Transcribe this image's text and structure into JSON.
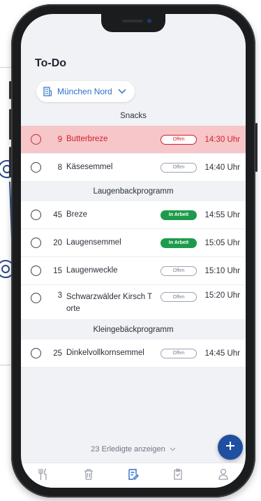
{
  "header": {
    "title": "To-Do"
  },
  "location": {
    "label": "München Nord"
  },
  "sections": [
    {
      "title": "Snacks",
      "items": [
        {
          "qty": "9",
          "name": "Butterbreze",
          "status": "Offen",
          "time": "14:30 Uhr",
          "variant": "alert"
        },
        {
          "qty": "8",
          "name": "Käsesemmel",
          "status": "Offen",
          "time": "14:40 Uhr",
          "variant": "open"
        }
      ]
    },
    {
      "title": "Laugenbackprogramm",
      "items": [
        {
          "qty": "45",
          "name": "Breze",
          "status": "In Arbeit",
          "time": "14:55 Uhr",
          "variant": "progress"
        },
        {
          "qty": "20",
          "name": "Laugensemmel",
          "status": "In Arbeit",
          "time": "15:05 Uhr",
          "variant": "progress"
        },
        {
          "qty": "15",
          "name": "Laugenweckle",
          "status": "Offen",
          "time": "15:10 Uhr",
          "variant": "open"
        },
        {
          "qty": "3",
          "name": "Schwarzwälder Kirsch T orte",
          "status": "Offen",
          "time": "15:20 Uhr",
          "variant": "open"
        }
      ]
    },
    {
      "title": "Kleingebäckprogramm",
      "items": [
        {
          "qty": "25",
          "name": "Dinkelvollkornsemmel",
          "status": "Offen",
          "time": "14:45 Uhr",
          "variant": "open"
        }
      ]
    }
  ],
  "footer": {
    "done_label": "23 Erledigte anzeigen"
  },
  "tabs": [
    {
      "icon": "cutlery-icon"
    },
    {
      "icon": "trash-icon"
    },
    {
      "icon": "list-edit-icon",
      "active": true
    },
    {
      "icon": "clipboard-icon"
    },
    {
      "icon": "user-icon"
    }
  ],
  "colors": {
    "accent": "#2d6fc7",
    "alert": "#d11f2b",
    "alert_bg": "#f6c6c9",
    "progress": "#1c9c4a",
    "fab": "#1f4fa0"
  }
}
